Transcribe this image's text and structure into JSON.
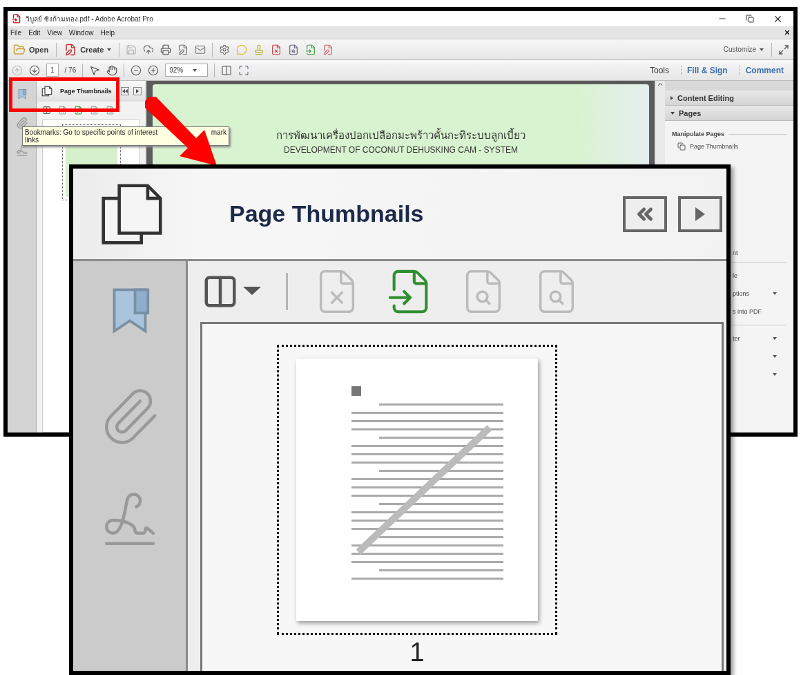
{
  "window": {
    "title": "วิบูลย์ ซิงก้ามทอง.pdf - Adobe Acrobat Pro"
  },
  "menu": [
    "File",
    "Edit",
    "View",
    "Window",
    "Help"
  ],
  "toolbar": {
    "open": "Open",
    "create": "Create",
    "customize": "Customize"
  },
  "navigation": {
    "page": "1",
    "total": "/ 76",
    "zoom": "92%"
  },
  "task_tabs": [
    {
      "label": "Tools",
      "kind": "plain"
    },
    {
      "label": "Fill & Sign",
      "kind": "link"
    },
    {
      "label": "Comment",
      "kind": "link"
    }
  ],
  "nav_panel": {
    "title": "Page Thumbnails",
    "highlighted": true
  },
  "tooltip": {
    "parts": [
      "Bookmarks: Go to specific points of interest",
      "mark",
      "links"
    ]
  },
  "document": {
    "title_th": "การพัฒนาเครื่องปอกเปลือกมะพร้าวคั้นกะทิระบบลูกเบี้ยว",
    "title_en": "DEVELOPMENT OF COCONUT DEHUSKING CAM - SYSTEM"
  },
  "right_pane": {
    "sections": [
      {
        "label": "Content Editing",
        "expanded": false
      },
      {
        "label": "Pages",
        "expanded": true
      }
    ],
    "group": "Manipulate Pages",
    "groups": [
      {
        "items": [
          {
            "label": "Page Thumbnails",
            "kind": "icon",
            "dropdown": false
          },
          {
            "label": "nt",
            "kind": "partial",
            "dropdown": false
          }
        ]
      },
      {
        "items": [
          {
            "label": "le",
            "kind": "partial",
            "dropdown": false
          },
          {
            "label": "ptions",
            "kind": "partial",
            "dropdown": true
          },
          {
            "label": "s into PDF",
            "kind": "partial",
            "dropdown": false
          }
        ]
      },
      {
        "items": [
          {
            "label": "ter",
            "kind": "partial",
            "dropdown": true
          },
          {
            "kind": "partial",
            "dropdown": true
          },
          {
            "kind": "partial",
            "dropdown": true
          }
        ]
      }
    ]
  },
  "zoom_inset": {
    "title": "Page Thumbnails",
    "page_label": "1"
  }
}
